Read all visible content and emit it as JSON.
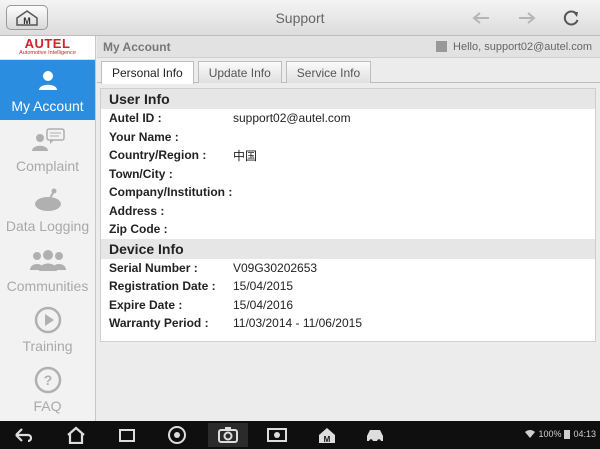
{
  "topbar": {
    "title": "Support",
    "home_icon_letter": "M"
  },
  "sidebar": {
    "logo": {
      "brand": "AUTEL",
      "tagline": "Automotive Intelligence",
      "color": "#d0232a"
    },
    "items": [
      {
        "label": "My Account",
        "icon": "user-icon",
        "active": true
      },
      {
        "label": "Complaint",
        "icon": "chat-bubbles-icon",
        "active": false
      },
      {
        "label": "Data Logging",
        "icon": "satellite-dish-icon",
        "active": false
      },
      {
        "label": "Communities",
        "icon": "group-icon",
        "active": false
      },
      {
        "label": "Training",
        "icon": "play-icon",
        "active": false
      },
      {
        "label": "FAQ",
        "icon": "question-icon",
        "active": false
      }
    ]
  },
  "header": {
    "section": "My Account",
    "greeting": "Hello, support02@autel.com"
  },
  "tabs": [
    {
      "label": "Personal Info",
      "active": true
    },
    {
      "label": "Update Info",
      "active": false
    },
    {
      "label": "Service Info",
      "active": false
    }
  ],
  "user_info": {
    "title": "User Info",
    "rows": [
      {
        "label": "Autel ID :",
        "value": "support02@autel.com"
      },
      {
        "label": "Your Name :",
        "value": ""
      },
      {
        "label": "Country/Region :",
        "value": "中国"
      },
      {
        "label": "Town/City :",
        "value": ""
      },
      {
        "label": "Company/Institution :",
        "value": ""
      },
      {
        "label": "Address :",
        "value": ""
      },
      {
        "label": "Zip Code :",
        "value": ""
      }
    ]
  },
  "device_info": {
    "title": "Device Info",
    "rows": [
      {
        "label": "Serial Number :",
        "value": "V09G30202653"
      },
      {
        "label": "Registration Date :",
        "value": "15/04/2015"
      },
      {
        "label": "Expire Date :",
        "value": "15/04/2016"
      },
      {
        "label": "Warranty Period :",
        "value": "11/03/2014 - 11/06/2015"
      }
    ]
  },
  "statusbar": {
    "battery": "100%",
    "time": "04:13"
  },
  "colors": {
    "accent": "#2a8de0",
    "brand": "#d0232a"
  }
}
